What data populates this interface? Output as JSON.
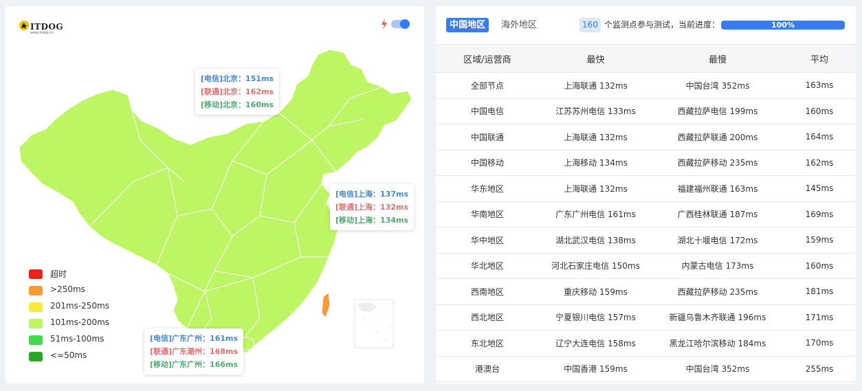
{
  "logo": {
    "name": "ITDOG",
    "sub": "www.itdog.cn"
  },
  "colors": {
    "map_fill": "#bef564",
    "map_border": "#ffffff",
    "taiwan_fill": "#f59b33",
    "accent": "#3a7cf0"
  },
  "tooltips": {
    "beijing": {
      "dx": "[电信]北京：151ms",
      "lt": "[联通]北京：162ms",
      "yd": "[移动]北京：160ms"
    },
    "shanghai": {
      "dx": "[电信]上海：137ms",
      "lt": "[联通]上海：132ms",
      "yd": "[移动]上海：134ms"
    },
    "guangzhou": {
      "dx": "[电信]广东广州：161ms",
      "lt": "[联通]广东潮州：168ms",
      "yd": "[移动]广东广州：166ms"
    }
  },
  "legend": [
    {
      "label": "超时",
      "color": "#e8231b"
    },
    {
      "label": ">250ms",
      "color": "#f59b33"
    },
    {
      "label": "201ms-250ms",
      "color": "#f6ea3e"
    },
    {
      "label": "101ms-200ms",
      "color": "#bef564"
    },
    {
      "label": "51ms-100ms",
      "color": "#44d94a"
    },
    {
      "label": "<=50ms",
      "color": "#27a826"
    }
  ],
  "tabs": {
    "active": "中国地区",
    "inactive": "海外地区"
  },
  "monitor": {
    "count": "160",
    "text": "个监测点参与测试，当前进度：",
    "progress": 100,
    "progress_label": "100%"
  },
  "table": {
    "headers": [
      "区域/运营商",
      "最快",
      "最慢",
      "平均"
    ],
    "rows": [
      [
        "全部节点",
        "上海联通 132ms",
        "中国台湾 352ms",
        "163ms"
      ],
      [
        "中国电信",
        "江苏苏州电信 133ms",
        "西藏拉萨电信 199ms",
        "160ms"
      ],
      [
        "中国联通",
        "上海联通 132ms",
        "西藏拉萨联通 200ms",
        "164ms"
      ],
      [
        "中国移动",
        "上海移动 134ms",
        "西藏拉萨移动 235ms",
        "162ms"
      ],
      [
        "华东地区",
        "上海联通 132ms",
        "福建福州联通 163ms",
        "145ms"
      ],
      [
        "华南地区",
        "广东广州电信 161ms",
        "广西桂林联通 187ms",
        "169ms"
      ],
      [
        "华中地区",
        "湖北武汉电信 138ms",
        "湖北十堰电信 172ms",
        "159ms"
      ],
      [
        "华北地区",
        "河北石家庄电信 150ms",
        "内蒙古电信 173ms",
        "160ms"
      ],
      [
        "西南地区",
        "重庆移动 159ms",
        "西藏拉萨移动 235ms",
        "181ms"
      ],
      [
        "西北地区",
        "宁夏银川电信 157ms",
        "新疆乌鲁木齐联通 196ms",
        "171ms"
      ],
      [
        "东北地区",
        "辽宁大连电信 158ms",
        "黑龙江哈尔滨移动 184ms",
        "170ms"
      ],
      [
        "港澳台",
        "中国香港 159ms",
        "中国台湾 352ms",
        "255ms"
      ]
    ]
  }
}
